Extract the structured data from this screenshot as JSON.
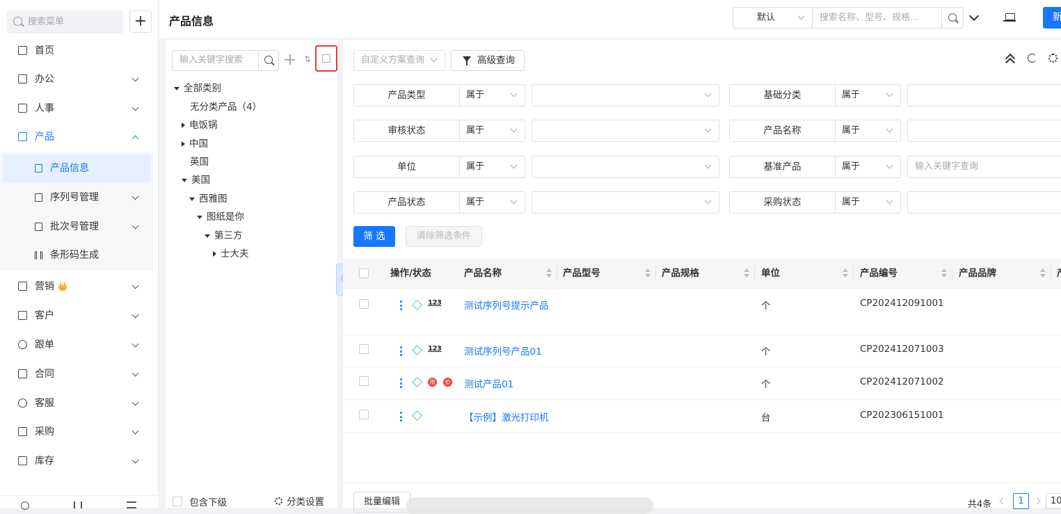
{
  "sidebar": {
    "search_placeholder": "搜索菜单",
    "add_label": "+",
    "items": [
      {
        "label": "首页"
      },
      {
        "label": "办公"
      },
      {
        "label": "人事"
      },
      {
        "label": "产品"
      },
      {
        "label": "营销"
      },
      {
        "label": "客户"
      },
      {
        "label": "跟单"
      },
      {
        "label": "合同"
      },
      {
        "label": "客服"
      },
      {
        "label": "采购"
      },
      {
        "label": "库存"
      }
    ],
    "sub_items": [
      {
        "label": "产品信息"
      },
      {
        "label": "序列号管理"
      },
      {
        "label": "批次号管理"
      },
      {
        "label": "条形码生成"
      }
    ],
    "crown_glyph": "👑"
  },
  "header": {
    "title": "产品信息",
    "scheme": "默认",
    "search_placeholder": "搜索名称、型号、规格...",
    "new_label": "新"
  },
  "tree": {
    "search_placeholder": "输入关键字搜索",
    "nodes": [
      {
        "label": "全部类别"
      },
      {
        "label": "无分类产品（4）"
      },
      {
        "label": "电饭锅"
      },
      {
        "label": "中国"
      },
      {
        "label": "英国"
      },
      {
        "label": "美国"
      },
      {
        "label": "西雅图"
      },
      {
        "label": "图纸是你"
      },
      {
        "label": "第三方"
      },
      {
        "label": "士大夫"
      }
    ],
    "include_sub": "包含下级",
    "category_settings": "分类设置",
    "collapse_glyph": "〈"
  },
  "toolbar": {
    "custom_query": "自定义方案查询",
    "advanced_query": "高级查询"
  },
  "filters": {
    "rows": [
      {
        "left_label": "产品类型",
        "left_op": "属于",
        "right_label": "基础分类",
        "right_op": "属于",
        "right_placeholder": ""
      },
      {
        "left_label": "审核状态",
        "left_op": "属于",
        "right_label": "产品名称",
        "right_op": "属于",
        "right_placeholder": ""
      },
      {
        "left_label": "单位",
        "left_op": "属于",
        "right_label": "基准产品",
        "right_op": "属于",
        "right_placeholder": "输入关键字查询"
      },
      {
        "left_label": "产品状态",
        "left_op": "属于",
        "right_label": "采购状态",
        "right_op": "属于",
        "right_placeholder": ""
      }
    ],
    "apply": "筛 选",
    "clear": "清除筛选条件"
  },
  "table": {
    "columns": [
      "操作/状态",
      "产品名称",
      "产品型号",
      "产品规格",
      "单位",
      "产品编号",
      "产品品牌",
      "产"
    ],
    "badges": {
      "n123": "123",
      "limit": "限",
      "price": "价"
    },
    "rows": [
      {
        "name": "测试序列号提示产品",
        "unit": "个",
        "code": "CP202412091001",
        "serial": true,
        "limit": false
      },
      {
        "name": "测试序列号产品01",
        "unit": "个",
        "code": "CP202412071003",
        "serial": true,
        "limit": false
      },
      {
        "name": "测试产品01",
        "unit": "个",
        "code": "CP202412071002",
        "serial": false,
        "limit": true
      },
      {
        "name": "【示例】激光打印机",
        "unit": "台",
        "code": "CP202306151001",
        "serial": false,
        "limit": false
      }
    ]
  },
  "footer": {
    "batch_edit": "批量编辑",
    "total": "共4条",
    "current_page": "1",
    "page_size": "10"
  }
}
